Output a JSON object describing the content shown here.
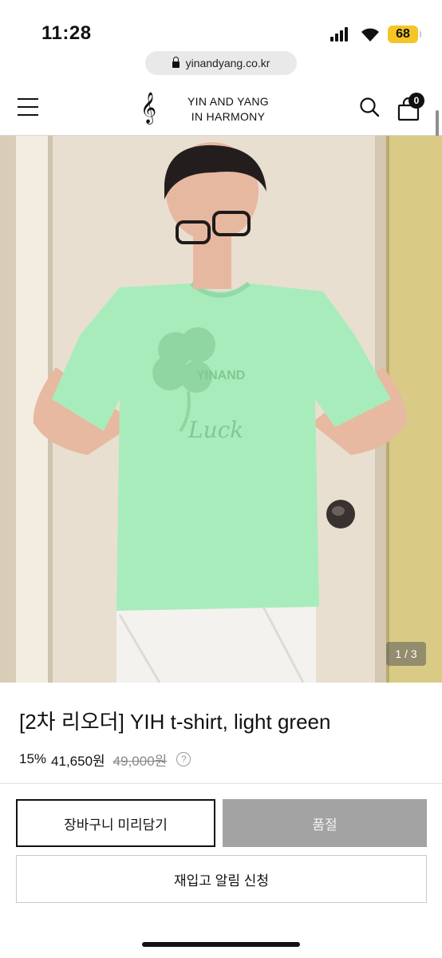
{
  "status_bar": {
    "time": "11:28",
    "battery": "68",
    "battery_color": "#f4c524"
  },
  "browser": {
    "url": "yinandyang.co.kr"
  },
  "header": {
    "brand_line1": "YIN AND YANG",
    "brand_line2": "IN HARMONY",
    "cart_count": "0",
    "icons": [
      "menu-icon",
      "treble-clef-logo",
      "search-icon",
      "shopping-bag-icon"
    ]
  },
  "gallery": {
    "counter": "1 / 3",
    "current": 1,
    "total": 3
  },
  "product": {
    "title": "[2차 리오더] YIH t-shirt, light green",
    "discount": "15%",
    "price": "41,650원",
    "original_price": "49,000원",
    "help_glyph": "?"
  },
  "buttons": {
    "add_to_cart": "장바구니 미리담기",
    "sold_out": "품절",
    "restock_alert": "재입고 알림 신청"
  },
  "colors": {
    "shirt": "#a9ecbc",
    "sold_out_bg": "#a3a3a3",
    "text": "#111111"
  }
}
